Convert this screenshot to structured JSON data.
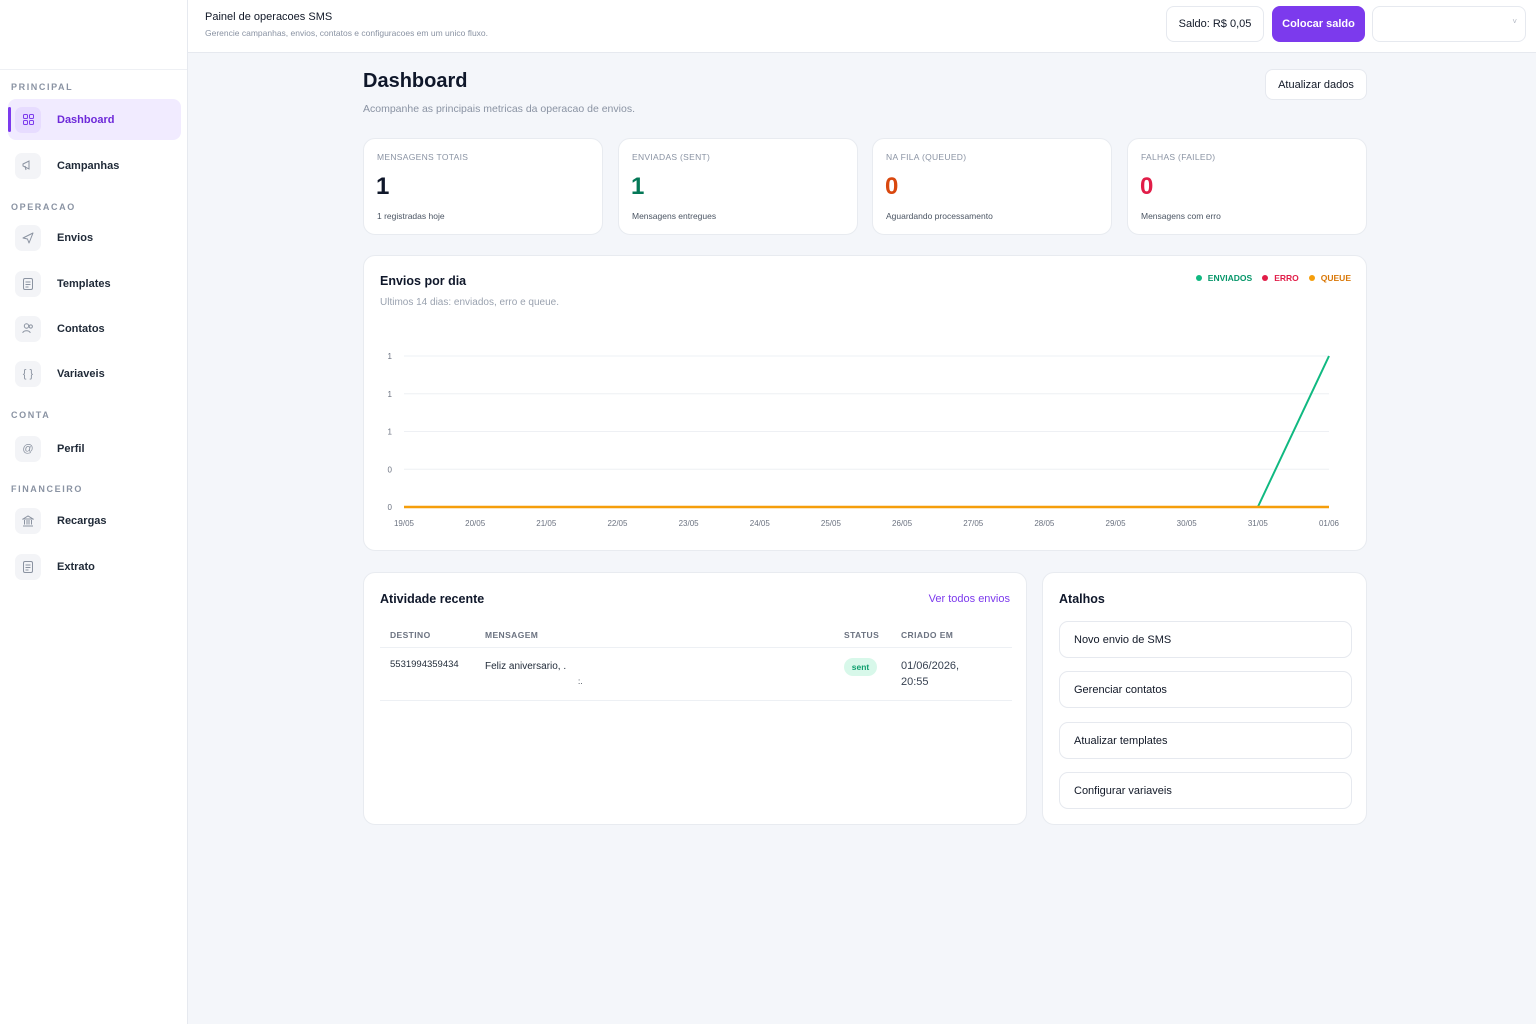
{
  "sidebar": {
    "sections": {
      "principal": "PRINCIPAL",
      "operacao": "OPERACAO",
      "conta": "CONTA",
      "financeiro": "FINANCEIRO"
    },
    "items": {
      "dashboard": "Dashboard",
      "campanhas": "Campanhas",
      "envios": "Envios",
      "templates": "Templates",
      "contatos": "Contatos",
      "variaveis": "Variaveis",
      "perfil": "Perfil",
      "recargas": "Recargas",
      "extrato": "Extrato"
    },
    "active_item": "dashboard"
  },
  "header": {
    "title": "Painel de operacoes SMS",
    "subtitle": "Gerencie campanhas, envios, contatos e configuracoes em um unico fluxo.",
    "balance": "Saldo: R$ 0,05",
    "add_balance": "Colocar saldo"
  },
  "page": {
    "title": "Dashboard",
    "subtitle": "Acompanhe as principais metricas da operacao de envios.",
    "refresh": "Atualizar dados"
  },
  "stats": [
    {
      "label": "MENSAGENS TOTAIS",
      "value": "1",
      "note": "1 registradas hoje",
      "color": "#0f172a"
    },
    {
      "label": "ENVIADAS (SENT)",
      "value": "1",
      "note": "Mensagens entregues",
      "color": "#047857"
    },
    {
      "label": "NA FILA (QUEUED)",
      "value": "0",
      "note": "Aguardando processamento",
      "color": "#d9480f"
    },
    {
      "label": "FALHAS (FAILED)",
      "value": "0",
      "note": "Mensagens com erro",
      "color": "#e11d48"
    }
  ],
  "chart_section": {
    "title": "Envios por dia",
    "subtitle": "Ultimos 14 dias: enviados, erro e queue."
  },
  "chart_data": {
    "type": "line",
    "x": [
      "19/05",
      "20/05",
      "21/05",
      "22/05",
      "23/05",
      "24/05",
      "25/05",
      "26/05",
      "27/05",
      "28/05",
      "29/05",
      "30/05",
      "31/05",
      "01/06"
    ],
    "series": [
      {
        "name": "ENVIADOS",
        "color": "#10b981",
        "values": [
          0,
          0,
          0,
          0,
          0,
          0,
          0,
          0,
          0,
          0,
          0,
          0,
          0,
          1
        ]
      },
      {
        "name": "ERRO",
        "color": "#e11d48",
        "values": [
          0,
          0,
          0,
          0,
          0,
          0,
          0,
          0,
          0,
          0,
          0,
          0,
          0,
          0
        ]
      },
      {
        "name": "QUEUE",
        "color": "#f59e0b",
        "values": [
          0,
          0,
          0,
          0,
          0,
          0,
          0,
          0,
          0,
          0,
          0,
          0,
          0,
          0
        ]
      }
    ],
    "y_ticks": [
      "1",
      "1",
      "1",
      "0",
      "0"
    ],
    "ylim": [
      0,
      1
    ],
    "grid": true,
    "legend": "top-right"
  },
  "recent": {
    "title": "Atividade recente",
    "see_all": "Ver todos envios",
    "headers": {
      "destino": "DESTINO",
      "mensagem": "MENSAGEM",
      "status": "STATUS",
      "criado": "CRIADO EM"
    },
    "rows": [
      {
        "destino": "5531994359434",
        "mensagem": "Feliz aniversario, .",
        "mensagem_2": ":.",
        "status": "sent",
        "date": "01/06/2026,",
        "time": "20:55"
      }
    ]
  },
  "shortcuts": {
    "title": "Atalhos",
    "items": [
      "Novo envio de SMS",
      "Gerenciar contatos",
      "Atualizar templates",
      "Configurar variaveis"
    ]
  },
  "icons": {
    "dashboard": "grid-icon",
    "campanhas": "megaphone-icon",
    "envios": "send-icon",
    "templates": "document-icon",
    "contatos": "users-icon",
    "variaveis": "braces-icon",
    "perfil": "at-sign-icon",
    "recargas": "bank-icon",
    "extrato": "receipt-icon"
  }
}
